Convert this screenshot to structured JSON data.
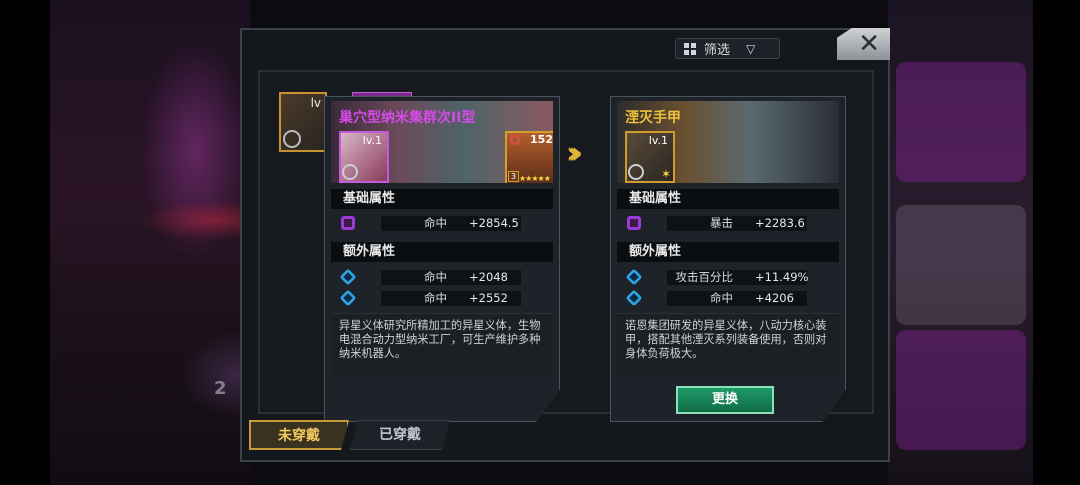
{
  "filter": {
    "label": "筛选",
    "arrow": "▽"
  },
  "close": {
    "label": "✕"
  },
  "background": {
    "number": "2"
  },
  "slot": {
    "level": "lv"
  },
  "compare_arrow": "›››",
  "left_card": {
    "title": "巢穴型纳米集群次II型",
    "level": "lv.1",
    "hero_level": "152",
    "hero_rank": "3",
    "hero_stars": "★★★★★",
    "base_header": "基础属性",
    "base_stats": [
      {
        "name": "命中",
        "value": "+2854.5"
      }
    ],
    "extra_header": "额外属性",
    "extra_stats": [
      {
        "name": "命中",
        "value": "+2048"
      },
      {
        "name": "命中",
        "value": "+2552"
      }
    ],
    "description": "异星义体研究所精加工的异星义体，生物电混合动力型纳米工厂，可生产维护多种纳米机器人。"
  },
  "right_card": {
    "title": "湮灭手甲",
    "level": "lv.1",
    "base_header": "基础属性",
    "base_stats": [
      {
        "name": "暴击",
        "value": "+2283.6"
      }
    ],
    "extra_header": "额外属性",
    "extra_stats": [
      {
        "name": "攻击百分比",
        "value": "+11.49%"
      },
      {
        "name": "命中",
        "value": "+4206"
      }
    ],
    "description": "诺恩集团研发的异星义体，八动力核心装甲，搭配其他湮灭系列装备使用，否则对身体负荷极大。",
    "replace_label": "更换"
  },
  "tabs": [
    {
      "label": "未穿戴",
      "active": true
    },
    {
      "label": "已穿戴",
      "active": false
    }
  ],
  "colors": {
    "rare_purple": "#d44be6",
    "legend_gold": "#f0c23a",
    "replace_green": "#1f9a6a"
  }
}
